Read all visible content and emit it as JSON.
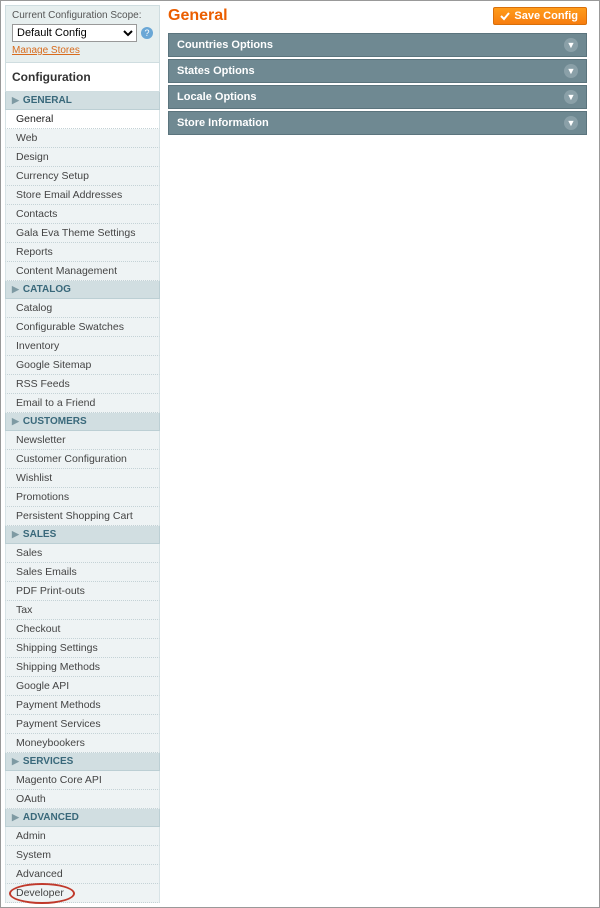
{
  "scope": {
    "label": "Current Configuration Scope:",
    "selected": "Default Config",
    "manage_link": "Manage Stores"
  },
  "config_title": "Configuration",
  "sections": [
    {
      "title": "GENERAL",
      "items": [
        {
          "label": "General",
          "active": true
        },
        {
          "label": "Web"
        },
        {
          "label": "Design"
        },
        {
          "label": "Currency Setup"
        },
        {
          "label": "Store Email Addresses"
        },
        {
          "label": "Contacts"
        },
        {
          "label": "Gala Eva Theme Settings"
        },
        {
          "label": "Reports"
        },
        {
          "label": "Content Management"
        }
      ]
    },
    {
      "title": "CATALOG",
      "items": [
        {
          "label": "Catalog"
        },
        {
          "label": "Configurable Swatches"
        },
        {
          "label": "Inventory"
        },
        {
          "label": "Google Sitemap"
        },
        {
          "label": "RSS Feeds"
        },
        {
          "label": "Email to a Friend"
        }
      ]
    },
    {
      "title": "CUSTOMERS",
      "items": [
        {
          "label": "Newsletter"
        },
        {
          "label": "Customer Configuration"
        },
        {
          "label": "Wishlist"
        },
        {
          "label": "Promotions"
        },
        {
          "label": "Persistent Shopping Cart"
        }
      ]
    },
    {
      "title": "SALES",
      "items": [
        {
          "label": "Sales"
        },
        {
          "label": "Sales Emails"
        },
        {
          "label": "PDF Print-outs"
        },
        {
          "label": "Tax"
        },
        {
          "label": "Checkout"
        },
        {
          "label": "Shipping Settings"
        },
        {
          "label": "Shipping Methods"
        },
        {
          "label": "Google API"
        },
        {
          "label": "Payment Methods"
        },
        {
          "label": "Payment Services"
        },
        {
          "label": "Moneybookers"
        }
      ]
    },
    {
      "title": "SERVICES",
      "items": [
        {
          "label": "Magento Core API"
        },
        {
          "label": "OAuth"
        }
      ]
    },
    {
      "title": "ADVANCED",
      "items": [
        {
          "label": "Admin"
        },
        {
          "label": "System"
        },
        {
          "label": "Advanced"
        },
        {
          "label": "Developer",
          "circled": true
        }
      ]
    }
  ],
  "main": {
    "title": "General",
    "save_label": "Save Config",
    "panels": [
      {
        "label": "Countries Options"
      },
      {
        "label": "States Options"
      },
      {
        "label": "Locale Options"
      },
      {
        "label": "Store Information"
      }
    ]
  }
}
